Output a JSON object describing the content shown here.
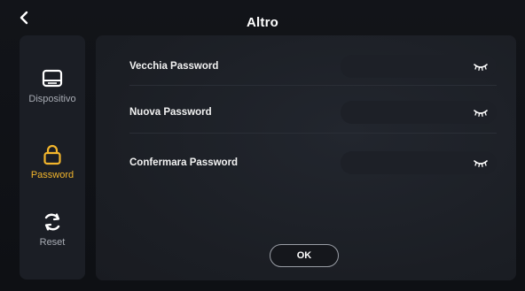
{
  "header": {
    "title": "Altro"
  },
  "sidebar": {
    "items": [
      {
        "label": "Dispositivo",
        "icon": "monitor-icon",
        "active": false
      },
      {
        "label": "Password",
        "icon": "lock-icon",
        "active": true
      },
      {
        "label": "Reset",
        "icon": "refresh-icon",
        "active": false
      }
    ]
  },
  "form": {
    "old_password_label": "Vecchia Password",
    "new_password_label": "Nuova Password",
    "confirm_password_label": "Confermara Password",
    "ok_label": "OK"
  },
  "colors": {
    "accent": "#f2b52c",
    "inactive_text": "#a8acb4",
    "panel_bg": "#1b1e24"
  }
}
